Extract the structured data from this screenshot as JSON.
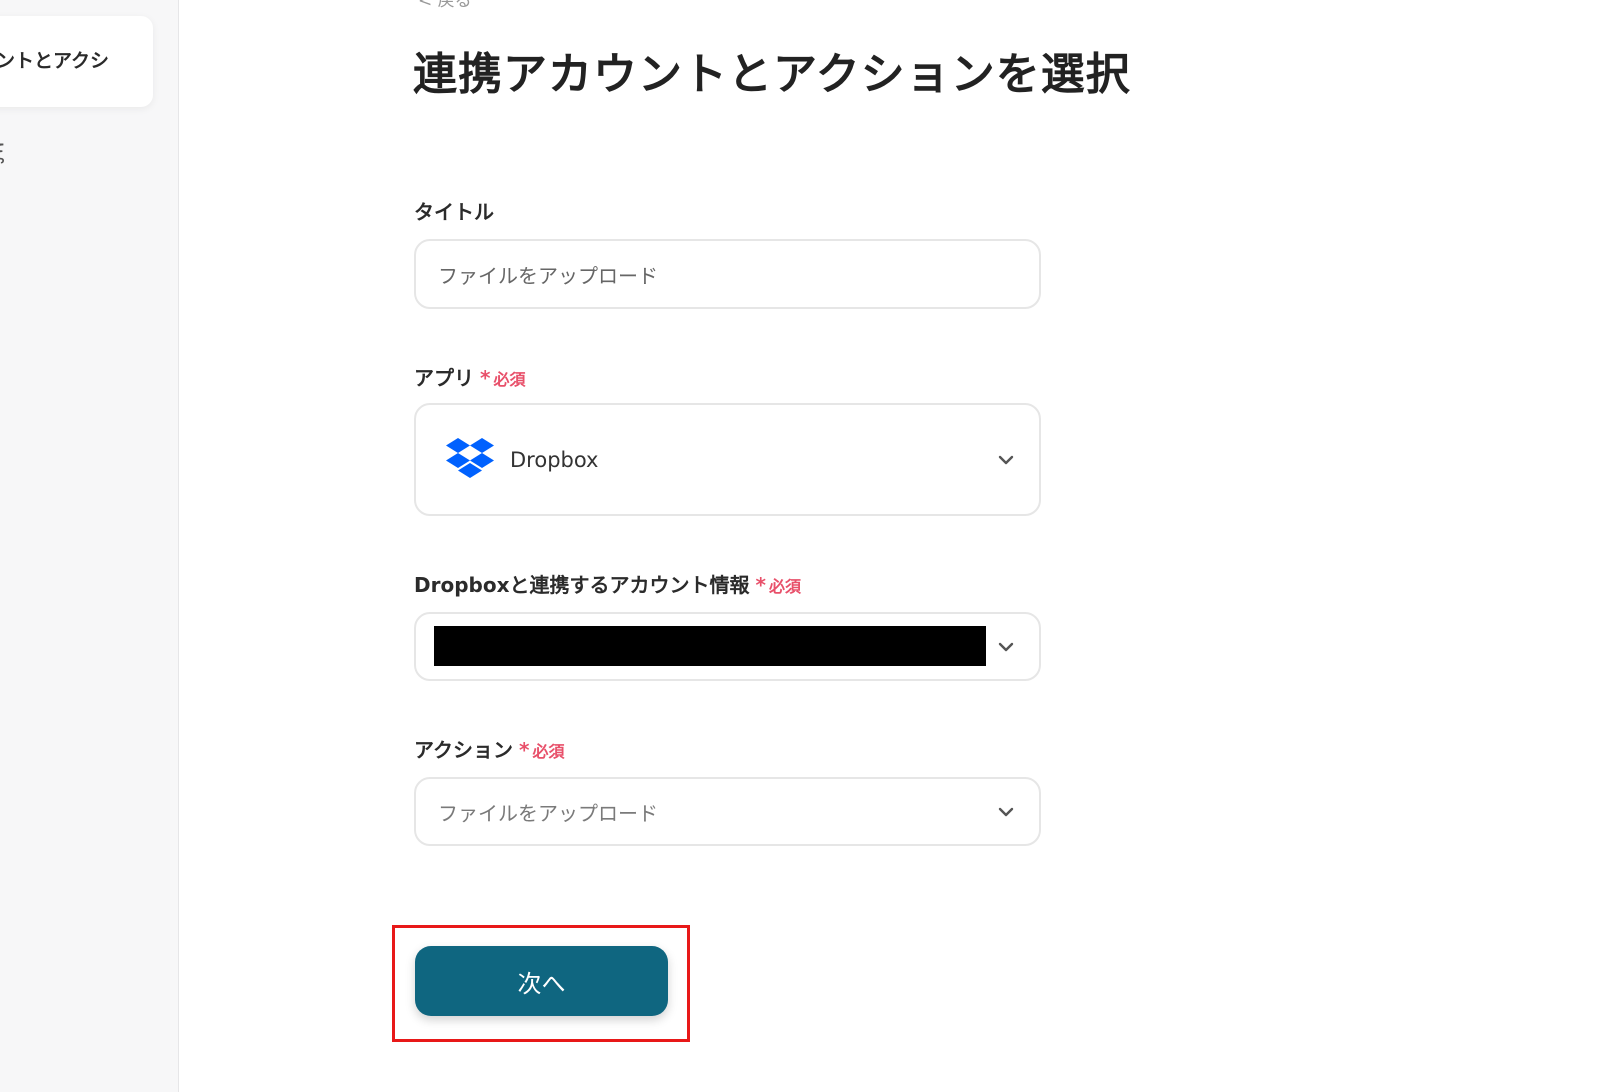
{
  "sidebar": {
    "active_step_label": "ントとアクシ",
    "next_step_mark": "ξ"
  },
  "header": {
    "back_label": "< 戻る",
    "title": "連携アカウントとアクションを選択"
  },
  "form": {
    "title_field": {
      "label": "タイトル",
      "value": "ファイルをアップロード"
    },
    "app_field": {
      "label": "アプリ",
      "required_mark": "*",
      "required_text": "必須",
      "selected_app": "Dropbox",
      "icon": "dropbox-icon"
    },
    "account_field": {
      "label": "Dropboxと連携するアカウント情報",
      "required_mark": "*",
      "required_text": "必須",
      "value_redacted": true
    },
    "action_field": {
      "label": "アクション",
      "required_mark": "*",
      "required_text": "必須",
      "selected_action": "ファイルをアップロード"
    }
  },
  "footer": {
    "next_label": "次へ"
  },
  "colors": {
    "primary_button": "#0f6680",
    "required": "#e8506a",
    "highlight": "#e81818",
    "dropbox_blue": "#0061fe"
  }
}
